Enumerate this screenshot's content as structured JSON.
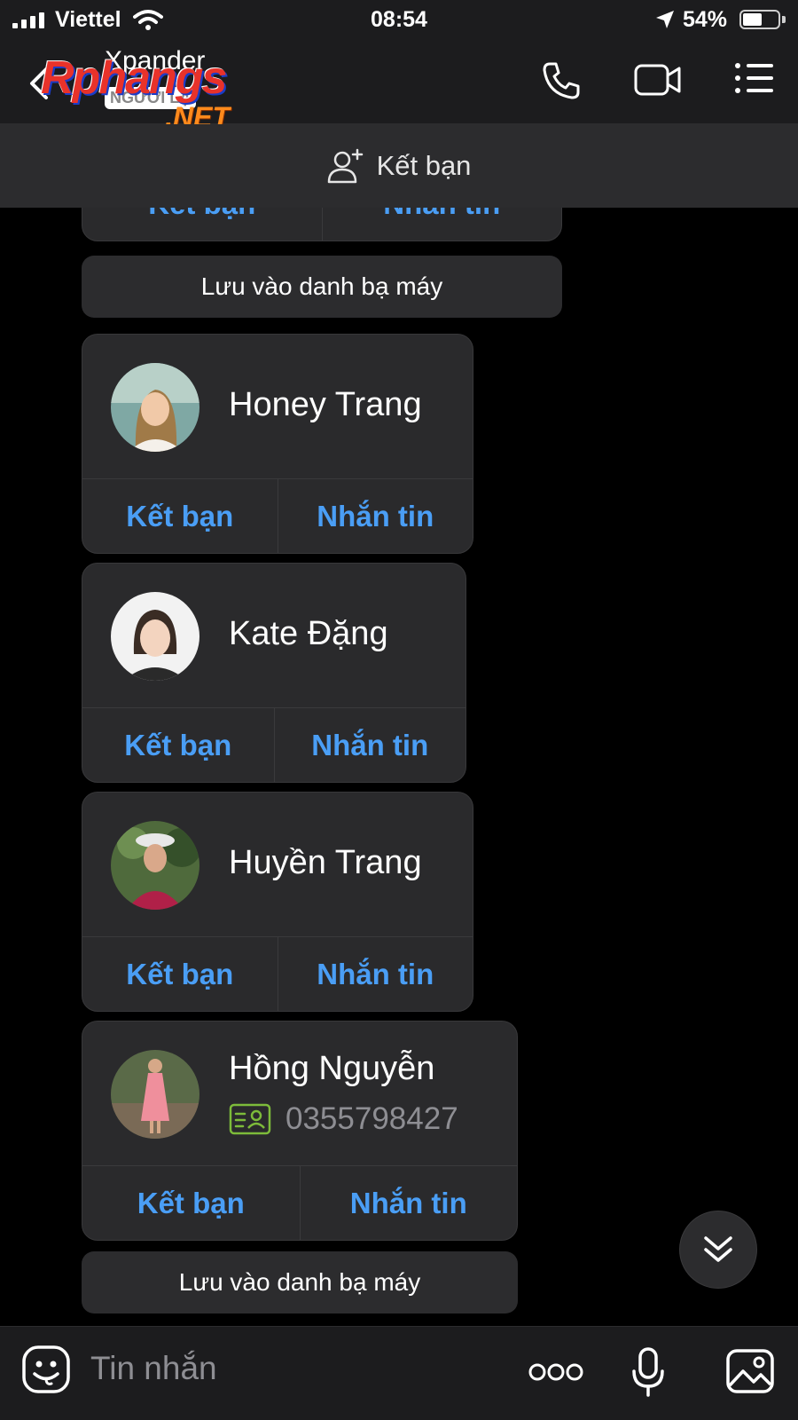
{
  "status_bar": {
    "carrier": "Viettel",
    "time": "08:54",
    "battery_percent": "54%",
    "battery_level": 0.54
  },
  "header": {
    "contact_name": "Xpander",
    "contact_subtitle": "NGƯỜI LẠ",
    "watermark_logo": "Rphangs",
    "watermark_domain": ".NET",
    "icons": [
      "back-icon",
      "phone-icon",
      "video-icon",
      "menu-list-icon"
    ]
  },
  "add_friend_bar": {
    "label": "Kết bạn",
    "icon": "add-user-icon"
  },
  "top_partial_card": {
    "add_friend_label": "Kết bạn",
    "message_label": "Nhắn tin"
  },
  "save_contact_label": "Lưu vào danh bạ máy",
  "contact_cards": [
    {
      "name": "Honey Trang",
      "add_friend_label": "Kết bạn",
      "message_label": "Nhắn tin"
    },
    {
      "name": "Kate Đặng",
      "add_friend_label": "Kết bạn",
      "message_label": "Nhắn tin"
    },
    {
      "name": "Huyền Trang",
      "add_friend_label": "Kết bạn",
      "message_label": "Nhắn tin"
    },
    {
      "name": "Hồng Nguyễn",
      "phone": "0355798427",
      "add_friend_label": "Kết bạn",
      "message_label": "Nhắn tin"
    }
  ],
  "input_bar": {
    "placeholder": "Tin nhắn",
    "icons": [
      "sticker-icon",
      "more-dots-icon",
      "microphone-icon",
      "image-icon"
    ]
  },
  "colors": {
    "accent_blue": "#4a9ef5",
    "card_bg": "#2a2a2c",
    "bar_bg": "#1c1c1e",
    "phone_card_icon": "#7dbb3a"
  }
}
